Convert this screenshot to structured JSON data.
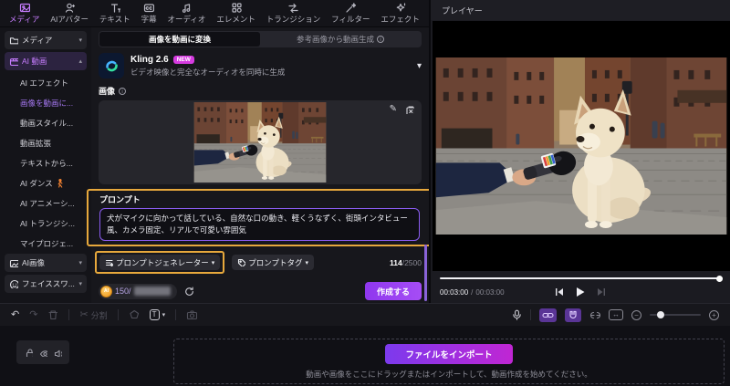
{
  "toolbar_tabs": [
    {
      "label": "メディア"
    },
    {
      "label": "AIアバター"
    },
    {
      "label": "テキスト"
    },
    {
      "label": "字幕"
    },
    {
      "label": "オーディオ"
    },
    {
      "label": "エレメント"
    },
    {
      "label": "トランジション"
    },
    {
      "label": "フィルター"
    },
    {
      "label": "エフェクト"
    }
  ],
  "sidebar": {
    "media": {
      "label": "メディア"
    },
    "ai_video": {
      "label": "AI 動画"
    },
    "sub_items": [
      {
        "label": "AI エフェクト"
      },
      {
        "label": "画像を動画に..."
      },
      {
        "label": "動画スタイル..."
      },
      {
        "label": "動画拡張"
      },
      {
        "label": "テキストから..."
      },
      {
        "label": "AI ダンス"
      },
      {
        "label": "AI アニメーシ..."
      },
      {
        "label": "AI トランジシ..."
      },
      {
        "label": "マイプロジェ..."
      }
    ],
    "ai_image": {
      "label": "AI画像"
    },
    "face_swap": {
      "label": "フェイススワ..."
    }
  },
  "panel": {
    "tab_convert": "画像を動画に変換",
    "tab_reference": "参考画像から動画生成",
    "model_name": "Kling 2.6",
    "model_badge": "NEW",
    "model_desc": "ビデオ映像と完全なオーディオを同時に生成",
    "image_label": "画像",
    "prompt_label": "プロンプト",
    "prompt_value": "犬がマイクに向かって話している、自然な口の動き、軽くうなずく、街頭インタビュー風、カメラ固定、リアルで可愛い雰囲気",
    "generator_button": "プロンプトジェネレーター",
    "tags_button": "プロンプトタグ",
    "char_count": "114",
    "char_max": "/2500",
    "credits_value": "150/",
    "create_button": "作成する"
  },
  "player": {
    "title": "プレイヤー",
    "time_current": "00:03:00",
    "time_separator": "/",
    "time_total": "00:03:00"
  },
  "timeline": {
    "split_label": "分割"
  },
  "dropzone": {
    "import_button": "ファイルをインポート",
    "hint": "動画や画像をここにドラッグまたはインポートして、動画作成を始めてください。"
  },
  "icons": {
    "undo": "↶",
    "redo": "↷",
    "scissors": "✂",
    "pencil": "✎",
    "chevron_down": "▾",
    "chevron_up": "▴",
    "info": "i",
    "text_tool": "T",
    "fit": "↔",
    "zoom_out": "−",
    "zoom_in": "+",
    "coin_label": "AI"
  },
  "colors": {
    "accent_purple": "#a259f7",
    "annotation_yellow": "#e7a83c",
    "prompt_border": "#8a5cf0",
    "new_badge": "#d63be0",
    "import_gradient_start": "#7c3aed",
    "import_gradient_end": "#c026d3"
  }
}
